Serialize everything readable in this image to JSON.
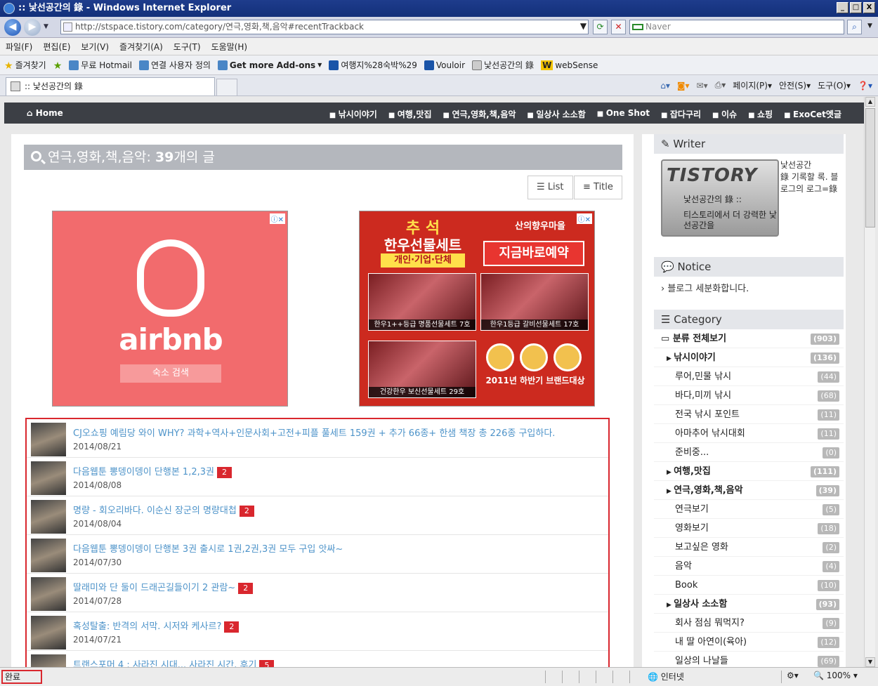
{
  "window": {
    "title": ":: 낯선공간의 錄 - Windows Internet Explorer",
    "controls": [
      "_",
      "□",
      "X"
    ]
  },
  "address": {
    "url": "http://stspace.tistory.com/category/연극,영화,책,음악#recentTrackback",
    "search_provider": "Naver"
  },
  "menu": [
    "파일(F)",
    "편집(E)",
    "보기(V)",
    "즐겨찾기(A)",
    "도구(T)",
    "도움말(H)"
  ],
  "favorites": {
    "label": "즐겨찾기",
    "items": [
      "무료 Hotmail",
      "연결 사용자 정의",
      "Get more Add-ons",
      "여행지%28숙박%29",
      "Vouloir",
      "낯선공간의 錄",
      "webSense"
    ]
  },
  "tab": {
    "title": ":: 낯선공간의 錄"
  },
  "commands": [
    "페이지(P)",
    "안전(S)",
    "도구(O)"
  ],
  "blognav": {
    "home": "Home",
    "items": [
      "낚시이야기",
      "여행,맛집",
      "연극,영화,책,음악",
      "일상사 소소함",
      "One Shot",
      "잡다구리",
      "이슈",
      "쇼핑",
      "ExoCet엣글"
    ]
  },
  "page": {
    "heading_cat": "연극,영화,책,음악:",
    "heading_count": "39",
    "heading_suffix": "개의 글",
    "view_list": "List",
    "view_title": "Title"
  },
  "ads": {
    "airbnb": {
      "wordmark": "airbnb",
      "button": "숙소 검색"
    },
    "hanwoo": {
      "title1": "추 석",
      "title2": "한우선물세트",
      "tag": "개인·기업·단체",
      "brand": "산의향우마을",
      "reserve": "지금바로예약",
      "cap1": "한우1++등급 명품선물세트 7호",
      "cap2": "한우1등급 갈비선물세트 17호",
      "cap3": "건강한우 보신선물세트 29호",
      "award": "2011년 하반기 브랜드대상"
    }
  },
  "posts": [
    {
      "title": "CJ오쇼핑 예림당 와이 WHY? 과학+역사+인문사회+고전+피플 풀세트 159권 + 추가 66종+ 한샘 책장 총 226종 구입하다.",
      "count": "",
      "date": "2014/08/21"
    },
    {
      "title": "다음웹툰 뽕뎅이뎅이 단행본 1,2,3권",
      "count": "2",
      "date": "2014/08/08"
    },
    {
      "title": "명량 - 회오리바다. 이순신 장군의 명량대첩",
      "count": "2",
      "date": "2014/08/04"
    },
    {
      "title": "다음웹툰 뽕뎅이뎅이 단행본 3권 출시로 1권,2권,3권 모두 구입 앗싸~",
      "count": "",
      "date": "2014/07/30"
    },
    {
      "title": "딸래미와 단 둘이 드래곤길들이기 2 관람~",
      "count": "2",
      "date": "2014/07/28"
    },
    {
      "title": "혹성탈출: 반격의 서막. 시저와 케사르?",
      "count": "2",
      "date": "2014/07/21"
    },
    {
      "title": "트랜스포머 4 : 사라진 시대... 사라진 시간. 후기",
      "count": "5",
      "date": ""
    }
  ],
  "sidebar": {
    "writer": {
      "title": "Writer",
      "logo_text": "TISTORY",
      "img_line1": "낯선공간의 錄 ::",
      "img_line2": "티스토리에서 더 강력한 낯선공간을",
      "name": "낯선공간",
      "desc": "錄 기록할 록. 블로그의 로그=錄"
    },
    "notice": {
      "title": "Notice",
      "item": "블로그 세분화합니다."
    },
    "category": {
      "title": "Category",
      "rows": [
        {
          "label": "분류 전체보기",
          "n": "(903)",
          "lvl": 0
        },
        {
          "label": "낚시이야기",
          "n": "(136)",
          "lvl": 1
        },
        {
          "label": "루어,민물 낚시",
          "n": "(44)",
          "lvl": 2
        },
        {
          "label": "바다,미끼 낚시",
          "n": "(68)",
          "lvl": 2
        },
        {
          "label": "전국 낚시 포인트",
          "n": "(11)",
          "lvl": 2
        },
        {
          "label": "아마추어 낚시대회",
          "n": "(11)",
          "lvl": 2
        },
        {
          "label": "준비중...",
          "n": "(0)",
          "lvl": 2
        },
        {
          "label": "여행,맛집",
          "n": "(111)",
          "lvl": 1
        },
        {
          "label": "연극,영화,책,음악",
          "n": "(39)",
          "lvl": 1
        },
        {
          "label": "연극보기",
          "n": "(5)",
          "lvl": 2
        },
        {
          "label": "영화보기",
          "n": "(18)",
          "lvl": 2
        },
        {
          "label": "보고싶은 영화",
          "n": "(2)",
          "lvl": 2
        },
        {
          "label": "음악",
          "n": "(4)",
          "lvl": 2
        },
        {
          "label": "Book",
          "n": "(10)",
          "lvl": 2
        },
        {
          "label": "일상사 소소함",
          "n": "(93)",
          "lvl": 1
        },
        {
          "label": "회사 점심 뭐먹지?",
          "n": "(9)",
          "lvl": 2
        },
        {
          "label": "내 딸 아연이(육아)",
          "n": "(12)",
          "lvl": 2
        },
        {
          "label": "일상의 나날들",
          "n": "(69)",
          "lvl": 2
        }
      ]
    }
  },
  "status": {
    "text": "완료",
    "zone": "인터넷",
    "zoom": "100%"
  }
}
